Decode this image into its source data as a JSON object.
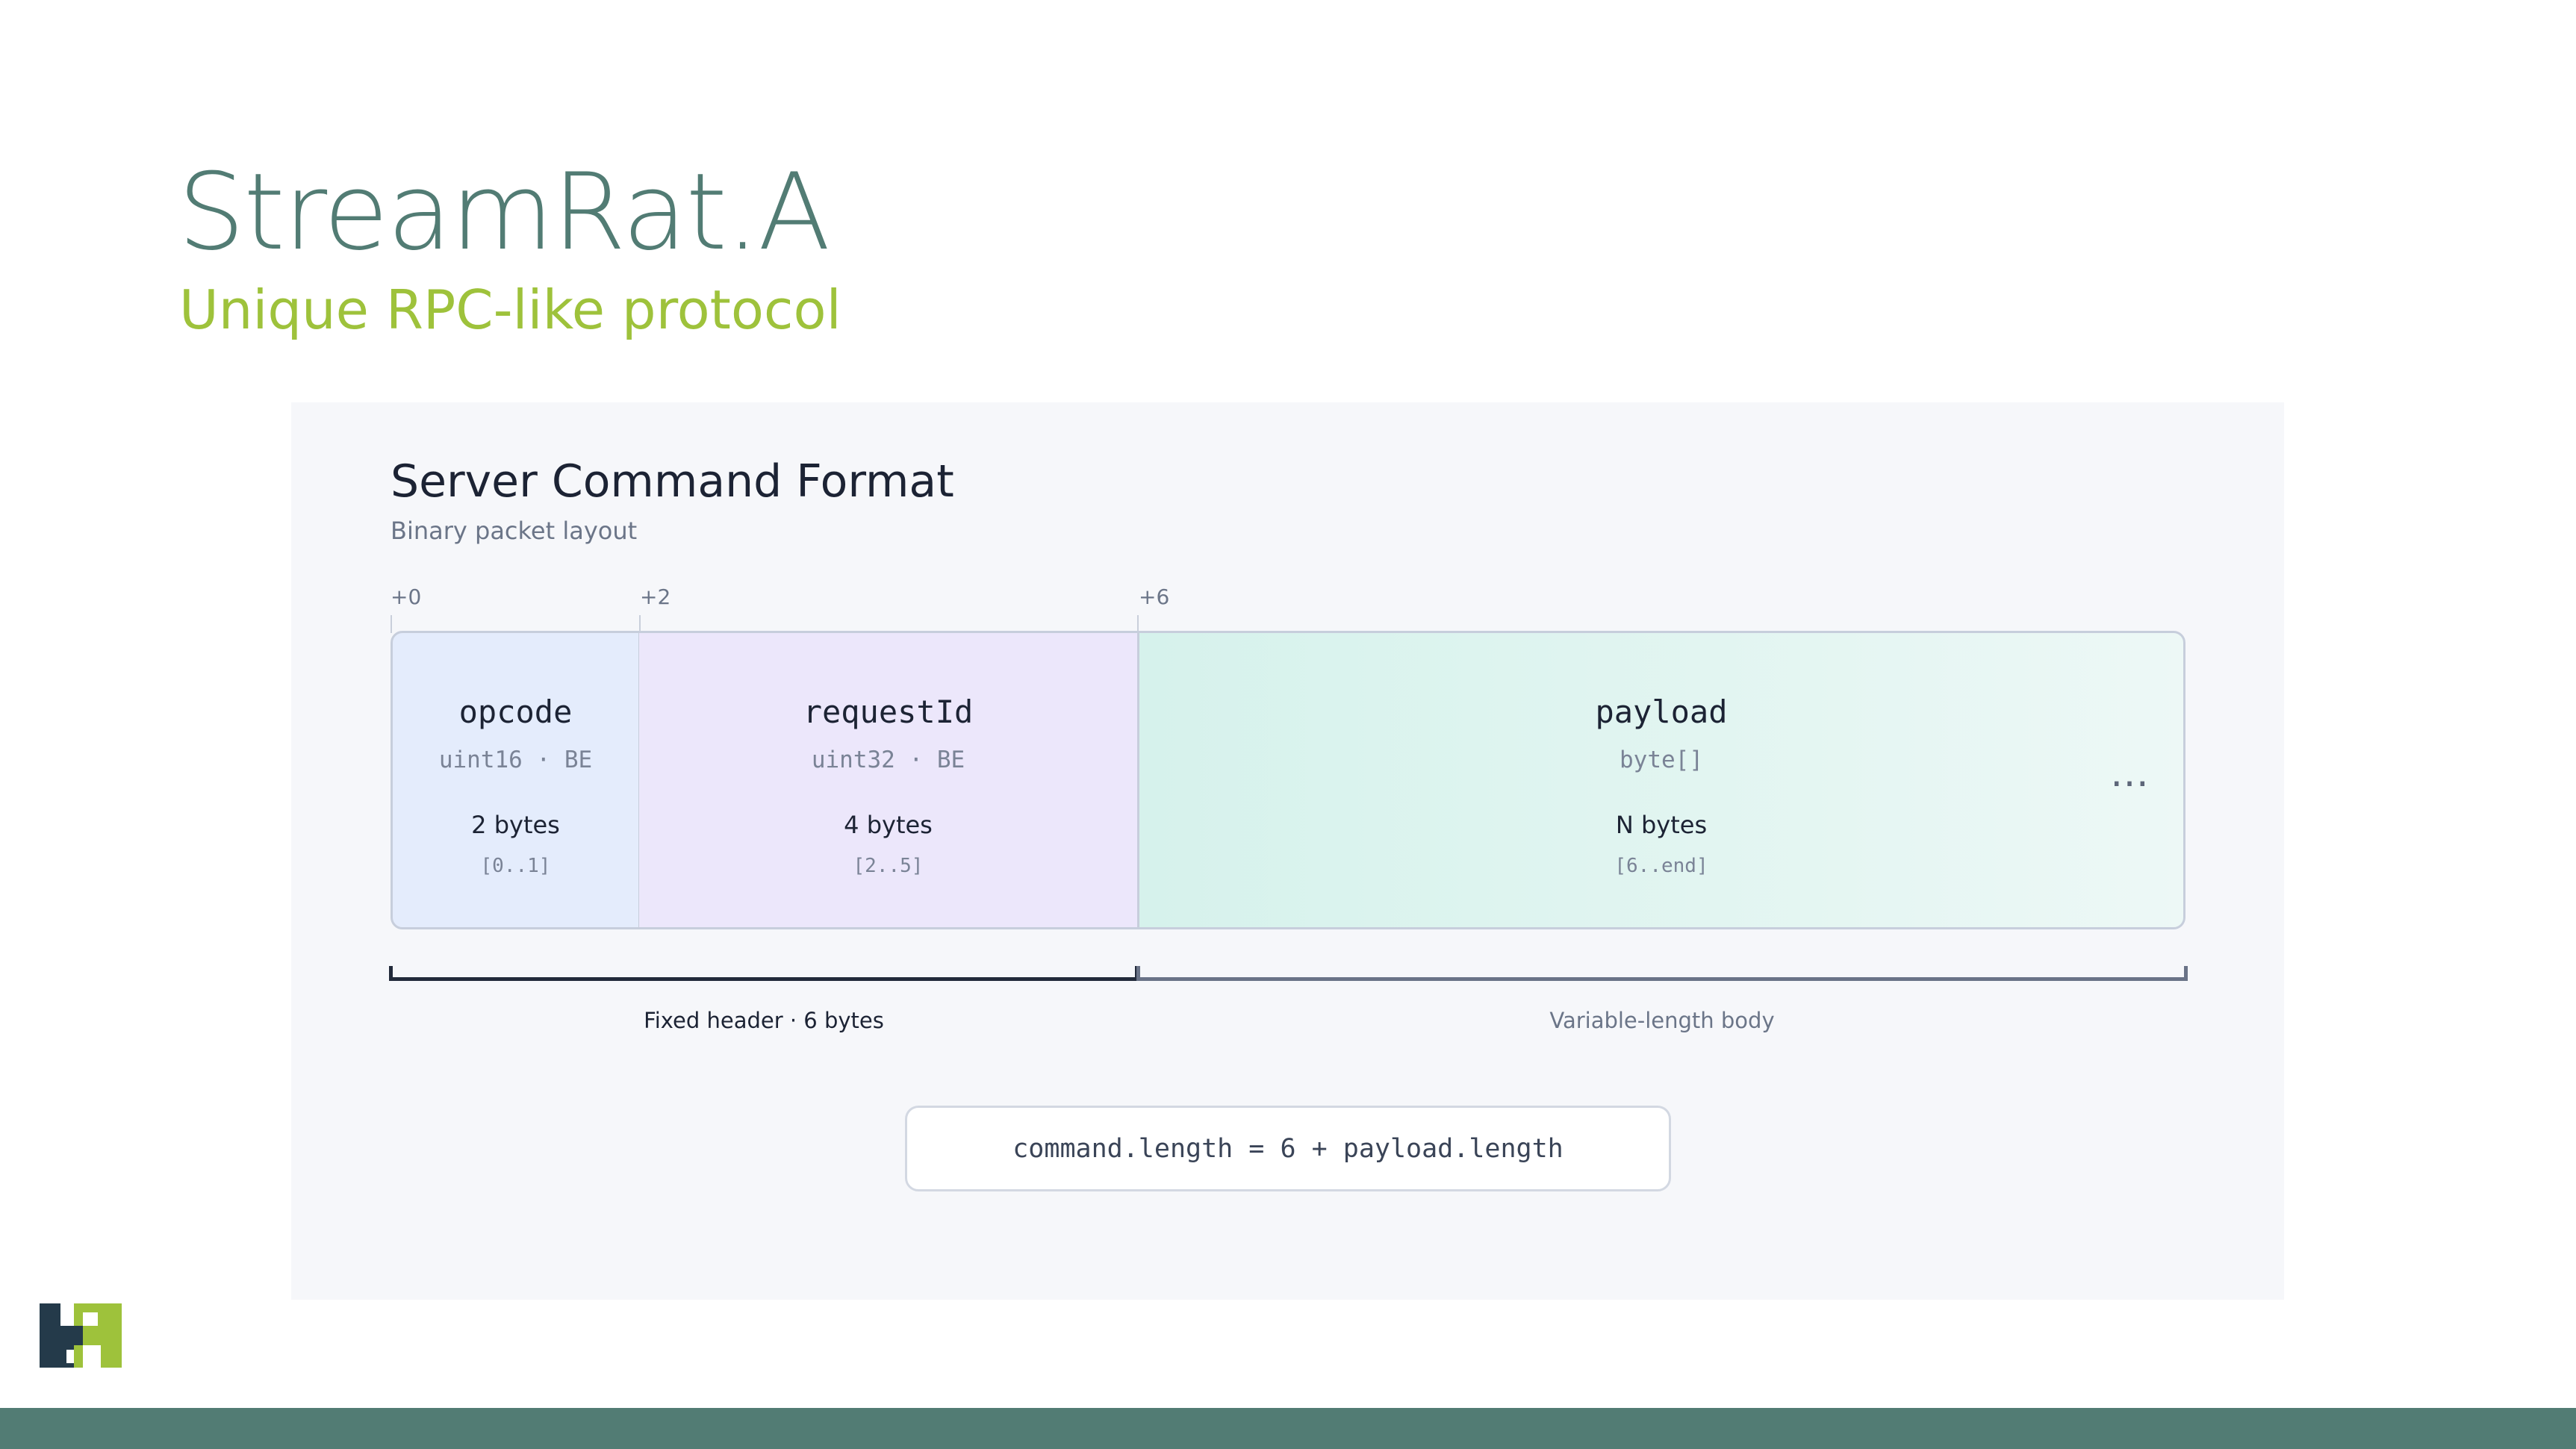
{
  "slide": {
    "title": "StreamRat.A",
    "subtitle": "Unique RPC-like protocol"
  },
  "diagram": {
    "title": "Server Command Format",
    "subtitle": "Binary packet layout",
    "offsets": [
      "+0",
      "+2",
      "+6"
    ],
    "fields": [
      {
        "name": "opcode",
        "type": "uint16 · BE",
        "size": "2 bytes",
        "range": "[0..1]"
      },
      {
        "name": "requestId",
        "type": "uint32 · BE",
        "size": "4 bytes",
        "range": "[2..5]"
      },
      {
        "name": "payload",
        "type": "byte[]",
        "size": "N bytes",
        "range": "[6..end]"
      }
    ],
    "continuation": "…",
    "groups": {
      "header": "Fixed header · 6 bytes",
      "body": "Variable-length body"
    },
    "formula": "command.length = 6 + payload.length"
  },
  "colors": {
    "title": "#527c74",
    "subtitle": "#9ec23b",
    "opcode_fill": "#e4ecfc",
    "requestId_fill": "#ece7fb",
    "payload_fill": "#d6f2ec",
    "footer_bar": "#527c74"
  },
  "icons": {
    "logo": "brand-logo-icon"
  }
}
